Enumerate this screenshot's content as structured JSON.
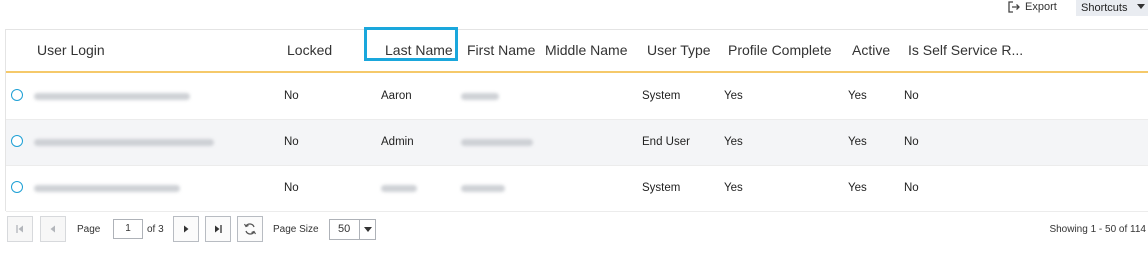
{
  "toolbar": {
    "export_label": "Export",
    "shortcuts_label": "Shortcuts"
  },
  "columns": [
    "User Login",
    "Locked",
    "Last Name",
    "First Name",
    "Middle Name",
    "User Type",
    "Profile Complete",
    "Active",
    "Is Self Service R..."
  ],
  "highlighted_column": "Last Name",
  "rows": [
    {
      "user_login": "[redacted]",
      "locked": "No",
      "last_name": "Aaron",
      "first_name": "[redacted]",
      "middle_name": "",
      "user_type": "System",
      "profile_complete": "Yes",
      "active": "Yes",
      "is_self_service": "No"
    },
    {
      "user_login": "[redacted]",
      "locked": "No",
      "last_name": "Admin",
      "first_name": "[redacted]",
      "middle_name": "",
      "user_type": "End User",
      "profile_complete": "Yes",
      "active": "Yes",
      "is_self_service": "No"
    },
    {
      "user_login": "[redacted]",
      "locked": "No",
      "last_name": "[redacted]",
      "first_name": "[redacted]",
      "middle_name": "",
      "user_type": "System",
      "profile_complete": "Yes",
      "active": "Yes",
      "is_self_service": "No"
    }
  ],
  "pager": {
    "page_label": "Page",
    "current_page": "1",
    "of_label": "of 3",
    "page_size_label": "Page Size",
    "page_size": "50",
    "showing": "Showing 1 - 50 of 114"
  },
  "colors": {
    "accent": "#1ea0d5",
    "header_underline": "#f5c96a",
    "highlight_box": "#1aa7dc"
  }
}
